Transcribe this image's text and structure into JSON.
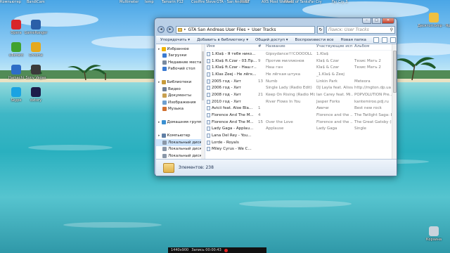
{
  "desktop": {
    "top_icons": [
      "Компьютер",
      "BandiCam",
      "Multimeter",
      "Iemp",
      "Tamarin P12",
      "Coolfire Steve",
      "GTA - San Andreas",
      "RUST",
      "AXS Most Wanted",
      "World of Tanks",
      "Far Cry",
      "Far Cry 3"
    ],
    "left_icons": [
      {
        "label": "Opera",
        "color": "#d8262b"
      },
      {
        "label": "GameRanger",
        "color": "#2a5fa8"
      },
      {
        "label": "uTorrent",
        "color": "#41a22e"
      },
      {
        "label": "Chrome",
        "color": "#e5a91c"
      },
      {
        "label": "Hamachi",
        "color": "#2d6dc6"
      },
      {
        "label": "Sony Vegas",
        "color": "#3a3a3a"
      },
      {
        "label": "Skype",
        "color": "#1aa3e2"
      },
      {
        "label": "dxtory",
        "color": "#1c1c4a"
      }
    ],
    "right_icons": [
      {
        "label": "Десктоп.bmp - Ярлык",
        "color": "#f0c040"
      },
      {
        "label": "Корзина",
        "color": "#c9d3dc"
      }
    ]
  },
  "window": {
    "controls": {
      "minimize": "–",
      "maximize": "□",
      "close": "✕"
    },
    "back_icon": "arrow-left-icon",
    "forward_icon": "arrow-right-icon",
    "breadcrumb": [
      "GTA San Andreas User Files",
      "User Tracks"
    ],
    "search_placeholder": "Поиск: User Tracks",
    "toolbar": {
      "organize": "Упорядочить ▾",
      "add_to_library": "Добавить в библиотеку ▾",
      "share": "Общий доступ ▾",
      "play_all": "Воспроизвести все",
      "new_folder": "Новая папка"
    },
    "nav": [
      {
        "label": "Избранное",
        "group": true,
        "color": "#f0b400"
      },
      {
        "label": "Загрузки",
        "group": false,
        "color": "#3b7ad1"
      },
      {
        "label": "Недавние места",
        "group": false,
        "color": "#7a8aa0"
      },
      {
        "label": "Рабочий стол",
        "group": false,
        "color": "#3b7ad1"
      },
      {
        "label": "",
        "group": false,
        "color": "transparent"
      },
      {
        "label": "Библиотеки",
        "group": true,
        "color": "#c89b3a"
      },
      {
        "label": "Видео",
        "group": false,
        "color": "#6e7f98"
      },
      {
        "label": "Документы",
        "group": false,
        "color": "#c8a050"
      },
      {
        "label": "Изображения",
        "group": false,
        "color": "#6fa0d0"
      },
      {
        "label": "Музыка",
        "group": false,
        "color": "#d07030"
      },
      {
        "label": "",
        "group": false,
        "color": "transparent"
      },
      {
        "label": "Домашняя группа",
        "group": true,
        "color": "#3a8fd1"
      },
      {
        "label": "",
        "group": false,
        "color": "transparent"
      },
      {
        "label": "Компьютер",
        "group": true,
        "color": "#5f7fa6"
      },
      {
        "label": "Локальный диск",
        "group": false,
        "color": "#8a97a8",
        "selected": true
      },
      {
        "label": "Локальный диск",
        "group": false,
        "color": "#8a97a8"
      },
      {
        "label": "Локальный диск",
        "group": false,
        "color": "#8a97a8"
      }
    ],
    "columns": {
      "name": "Имя",
      "num": "#",
      "title": "Название",
      "artist": "Участвующие исп...",
      "album": "Альбом"
    },
    "files": [
      {
        "name": "1.Kla$ - Я тебя нико...",
        "num": "",
        "title": "Gipsydance!!!COOOOLL",
        "artist": "1.Kla$",
        "album": ""
      },
      {
        "name": "1.Kla$ ft.Czar - 03.Пр...",
        "num": "9",
        "title": "Против миллионов",
        "artist": "Kla$ & Czar",
        "album": "Тезис Мать 2"
      },
      {
        "name": "1.Kla$ ft.Czar - Наш г...",
        "num": "",
        "title": "Наш ган",
        "artist": "Kla$ & Czar",
        "album": "Тезис Мать 2"
      },
      {
        "name": "1.Klas Zeej - Не лёгк...",
        "num": "",
        "title": "Не лёгкая штука",
        "artist": "_1.Kla$ & Zeej",
        "album": ""
      },
      {
        "name": "2005 год - Хит",
        "num": "13",
        "title": "Numb",
        "artist": "Linkin Park",
        "album": "Meteora"
      },
      {
        "name": "2006 год - Хит",
        "num": "",
        "title": "Single Lady (Radio Edit)",
        "artist": "DJ Layla feat. Alissa",
        "album": "http://mgton.dp.ua"
      },
      {
        "name": "2008 год - Хит",
        "num": "21",
        "title": "Keep On Rising (Radio Mix)",
        "artist": "Ian Carey feat. Mi...",
        "album": "POPVOLUTION Pre..."
      },
      {
        "name": "2010 год - Хит",
        "num": "",
        "title": "River Flows In You",
        "artist": "Jasper Forks",
        "album": "kantemiroo.pdj.ru"
      },
      {
        "name": "Avicii feat. Aloe Bla...",
        "num": "1",
        "title": "",
        "artist": "Авичи",
        "album": "Best new rock"
      },
      {
        "name": "Florence And The M...",
        "num": "4",
        "title": "",
        "artist": "Florence and the ...",
        "album": "The Twilight Saga: E..."
      },
      {
        "name": "Florence And The M...",
        "num": "15",
        "title": "Over the Love",
        "artist": "Florence and the ...",
        "album": "The Great Gatsby (M..."
      },
      {
        "name": "Lady Gaga - Applau...",
        "num": "",
        "title": "Applause",
        "artist": "Lady Gaga",
        "album": "Single"
      },
      {
        "name": "Lana Del Rey - You...",
        "num": "",
        "title": "",
        "artist": "",
        "album": ""
      },
      {
        "name": "Lorde - Royals",
        "num": "",
        "title": "",
        "artist": "",
        "album": ""
      },
      {
        "name": "Miley Cyrus - We C...",
        "num": "",
        "title": "",
        "artist": "",
        "album": ""
      }
    ],
    "status": "Элементов: 238"
  },
  "taskbar": {
    "resolution": "1440x900",
    "recording": "Запись 00:00:43"
  }
}
